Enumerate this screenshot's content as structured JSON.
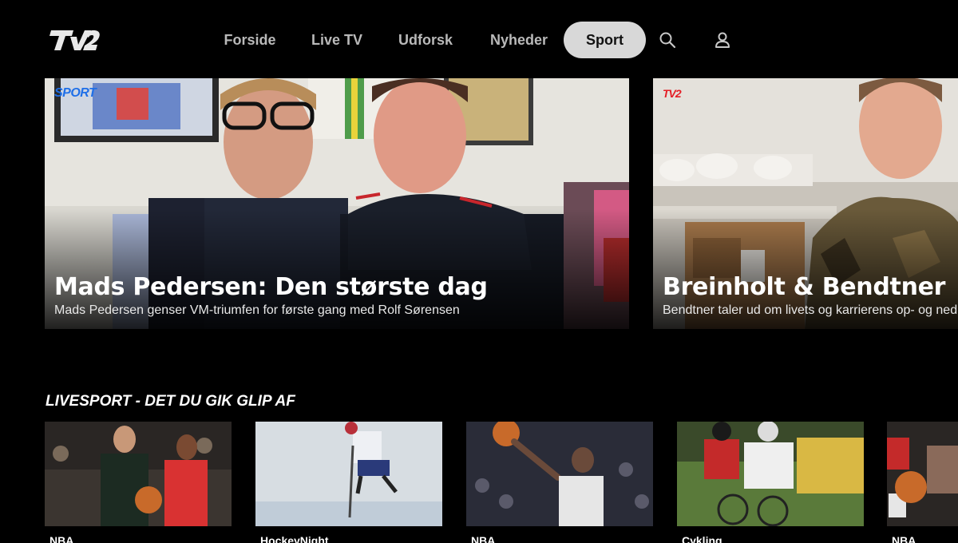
{
  "header": {
    "logo_text": "TV2",
    "nav": [
      {
        "label": "Forside",
        "active": false
      },
      {
        "label": "Live TV",
        "active": false
      },
      {
        "label": "Udforsk",
        "active": false
      },
      {
        "label": "Nyheder",
        "active": false
      },
      {
        "label": "Sport",
        "active": true
      }
    ],
    "icons": [
      "search-icon",
      "profile-icon"
    ]
  },
  "hero": [
    {
      "badge": "SPORT",
      "title": "Mads Pedersen: Den største dag",
      "subtitle": "Mads Pedersen genser VM-triumfen for første gang med Rolf Sørensen"
    },
    {
      "badge": "TV2",
      "title": "Breinholt & Bendtner",
      "subtitle": "Bendtner taler ud om livets og karrierens op- og ned"
    }
  ],
  "row": {
    "title": "LIVESPORT - DET DU GIK GLIP AF",
    "items": [
      {
        "label": "NBA"
      },
      {
        "label": "HockeyNight"
      },
      {
        "label": "NBA"
      },
      {
        "label": "Cykling"
      },
      {
        "label": "NBA"
      }
    ]
  },
  "colors": {
    "background": "#000000",
    "nav_active_bg": "#d8d8d8",
    "sport_badge": "#1f6fe8",
    "tv2_red": "#e41e26"
  }
}
